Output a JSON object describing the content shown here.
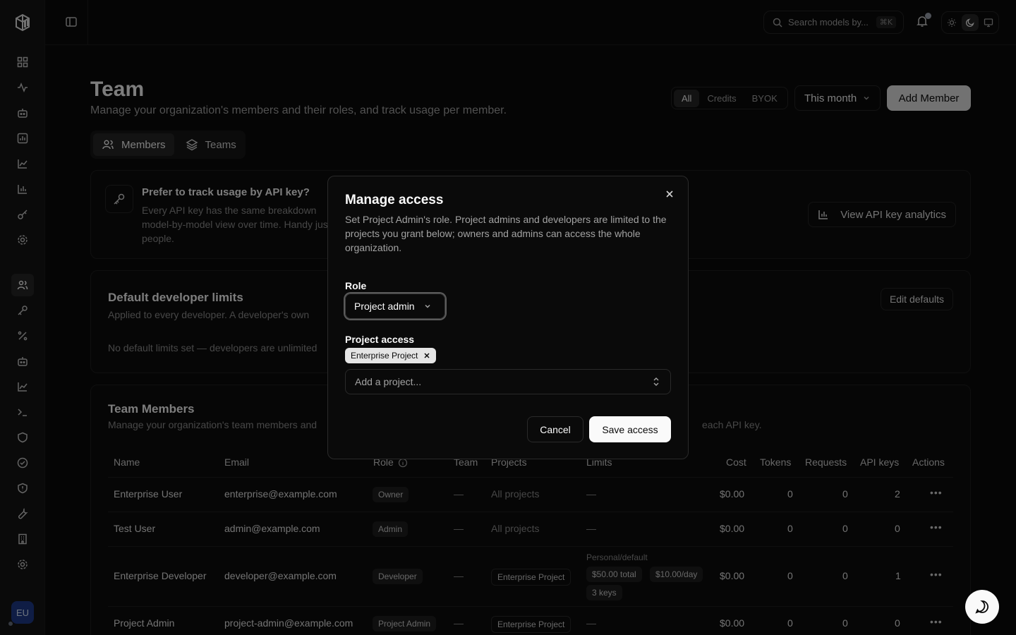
{
  "sidebar": {
    "avatar_initials": "EU"
  },
  "topbar": {
    "search_placeholder": "Search models by...",
    "search_shortcut": "⌘K"
  },
  "page": {
    "title": "Team",
    "subtitle": "Manage your organization's members and their roles, and track usage per member.",
    "filters": [
      "All",
      "Credits",
      "BYOK"
    ],
    "period": "This month",
    "add_member": "Add Member",
    "tabs": [
      "Members",
      "Teams"
    ]
  },
  "api_card": {
    "title": "Prefer to track usage by API key?",
    "body": "Every API key has the same breakdown model-by-model view over time. Handy just people.",
    "button": "View API key analytics"
  },
  "limits_card": {
    "title": "Default developer limits",
    "subtitle": "Applied to every developer. A developer's own",
    "empty": "No default limits set — developers are unlimited"
  },
  "limits_button": "Edit defaults",
  "members_card": {
    "title": "Team Members",
    "subtitle": "Manage your organization's team members and",
    "subtitle_tail": "each API key."
  },
  "table": {
    "headers": [
      "Name",
      "Email",
      "Role",
      "Team",
      "Projects",
      "Limits",
      "Cost",
      "Tokens",
      "Requests",
      "API keys",
      "Actions"
    ],
    "rows": [
      {
        "name": "Enterprise User",
        "email": "enterprise@example.com",
        "role": "Owner",
        "team": "—",
        "projects": "All projects",
        "limits": "—",
        "cost": "$0.00",
        "tokens": "0",
        "requests": "0",
        "api_keys": "2"
      },
      {
        "name": "Test User",
        "email": "admin@example.com",
        "role": "Admin",
        "team": "—",
        "projects": "All projects",
        "limits": "—",
        "cost": "$0.00",
        "tokens": "0",
        "requests": "0",
        "api_keys": "0"
      },
      {
        "name": "Enterprise Developer",
        "email": "developer@example.com",
        "role": "Developer",
        "team": "—",
        "projects": "Enterprise Project",
        "limits_label": "Personal/default",
        "limits_badges": [
          "$50.00 total",
          "$10.00/day",
          "3 keys"
        ],
        "cost": "$0.00",
        "tokens": "0",
        "requests": "0",
        "api_keys": "1"
      },
      {
        "name": "Project Admin",
        "email": "project-admin@example.com",
        "role": "Project Admin",
        "team": "—",
        "projects": "Enterprise Project",
        "limits": "—",
        "cost": "$0.00",
        "tokens": "0",
        "requests": "0",
        "api_keys": "0"
      }
    ]
  },
  "modal": {
    "title": "Manage access",
    "description": "Set Project Admin's role. Project admins and developers are limited to the projects you grant below; owners and admins can access the whole organization.",
    "role_label": "Role",
    "role_value": "Project admin",
    "project_label": "Project access",
    "project_chip": "Enterprise Project",
    "add_placeholder": "Add a project...",
    "cancel": "Cancel",
    "save": "Save access"
  },
  "colors": {
    "background": "#0a0a0a",
    "avatar": "#1e3a8a",
    "primary_button": "#fafafa"
  },
  "icons": [
    "logo-icon",
    "panel-toggle-icon",
    "search-icon",
    "bell-icon",
    "sun-icon",
    "moon-icon",
    "monitor-icon",
    "users-icon",
    "layers-icon",
    "key-icon",
    "bar-chart-icon",
    "close-icon",
    "chevron-down-icon",
    "chevrons-up-down-icon",
    "chat-icon"
  ]
}
